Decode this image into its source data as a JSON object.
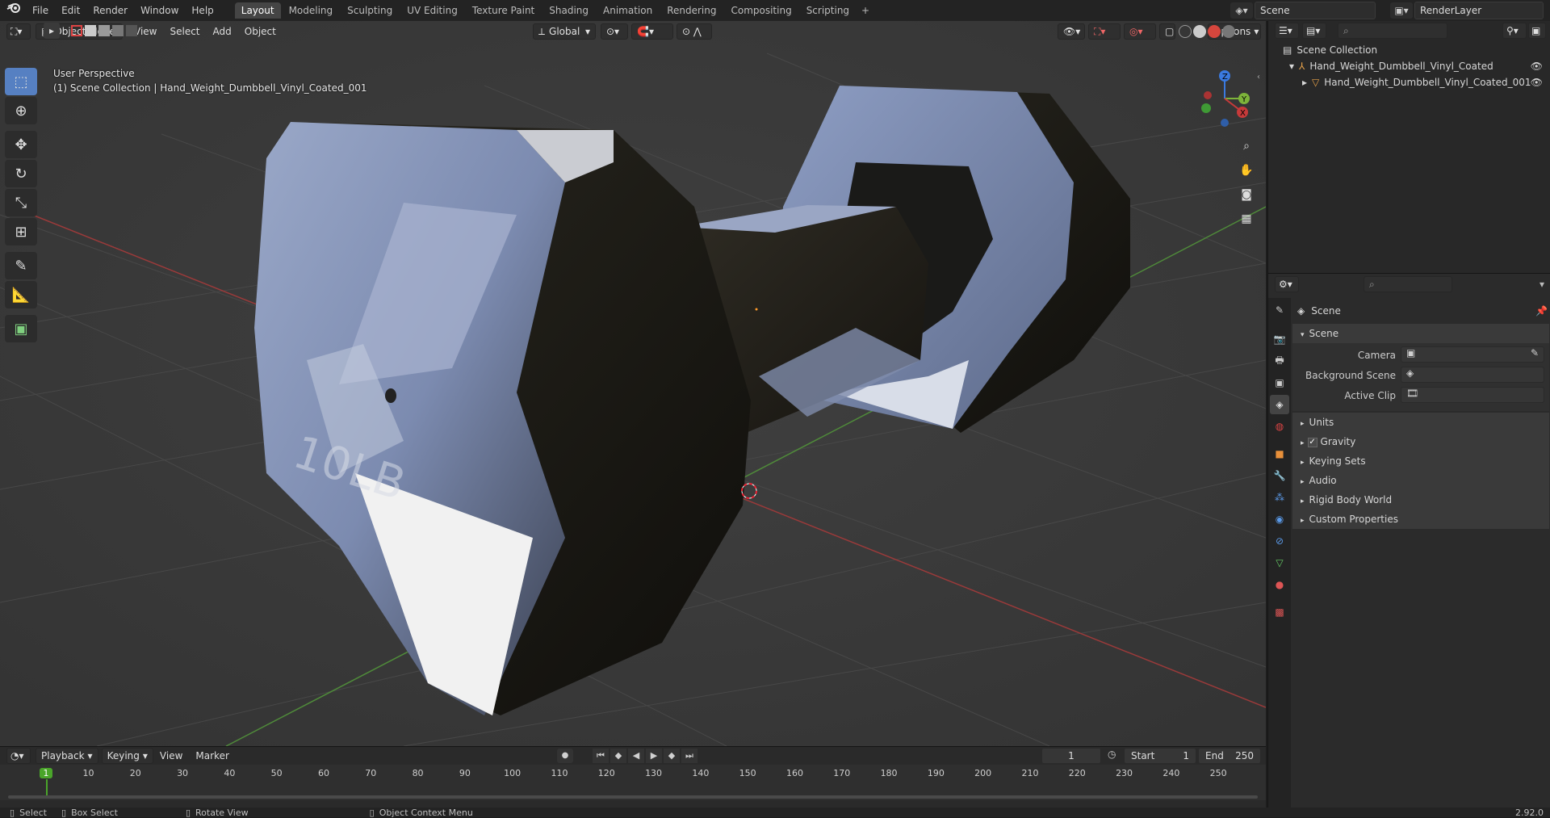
{
  "top_menu": {
    "logo": "blender-logo-icon",
    "items": [
      "File",
      "Edit",
      "Render",
      "Window",
      "Help"
    ]
  },
  "workspaces": [
    "Layout",
    "Modeling",
    "Sculpting",
    "UV Editing",
    "Texture Paint",
    "Shading",
    "Animation",
    "Rendering",
    "Compositing",
    "Scripting"
  ],
  "active_workspace": "Layout",
  "scene_name": "Scene",
  "render_layer": "RenderLayer",
  "viewport_header": {
    "mode": "Object Mode",
    "menus": [
      "View",
      "Select",
      "Add",
      "Object"
    ],
    "orientation": "Global",
    "options": "Options"
  },
  "viewport": {
    "perspective_label": "User Perspective",
    "collection_label": "(1) Scene Collection | Hand_Weight_Dumbbell_Vinyl_Coated_001",
    "dumbbell_text": "10LB",
    "gizmo": {
      "x": "X",
      "y": "Y",
      "z": "Z"
    }
  },
  "outliner": {
    "root": "Scene Collection",
    "items": [
      "Hand_Weight_Dumbbell_Vinyl_Coated",
      "Hand_Weight_Dumbbell_Vinyl_Coated_001"
    ]
  },
  "properties": {
    "context": "Scene",
    "panel_title": "Scene",
    "camera_label": "Camera",
    "background_scene_label": "Background Scene",
    "active_clip_label": "Active Clip",
    "collapsed_panels": [
      "Units",
      "Gravity",
      "Keying Sets",
      "Audio",
      "Rigid Body World",
      "Custom Properties"
    ],
    "gravity_checked": true
  },
  "timeline": {
    "menus": [
      "Playback",
      "Keying",
      "View",
      "Marker"
    ],
    "current_frame": "1",
    "start_label": "Start",
    "start": "1",
    "end_label": "End",
    "end": "250",
    "ruler_ticks": [
      "1",
      "10",
      "20",
      "30",
      "40",
      "50",
      "60",
      "70",
      "80",
      "90",
      "100",
      "110",
      "120",
      "130",
      "140",
      "150",
      "160",
      "170",
      "180",
      "190",
      "200",
      "210",
      "220",
      "230",
      "240",
      "250"
    ]
  },
  "statusbar": {
    "select": "Select",
    "box_select": "Box Select",
    "rotate_view": "Rotate View",
    "context_menu": "Object Context Menu",
    "version": "2.92.0"
  },
  "colors": {
    "accent": "#5680c2",
    "active_frame": "#4aa52a",
    "axis_x": "#c63a3a",
    "axis_y": "#7db33a",
    "axis_z": "#3a7ae0"
  }
}
